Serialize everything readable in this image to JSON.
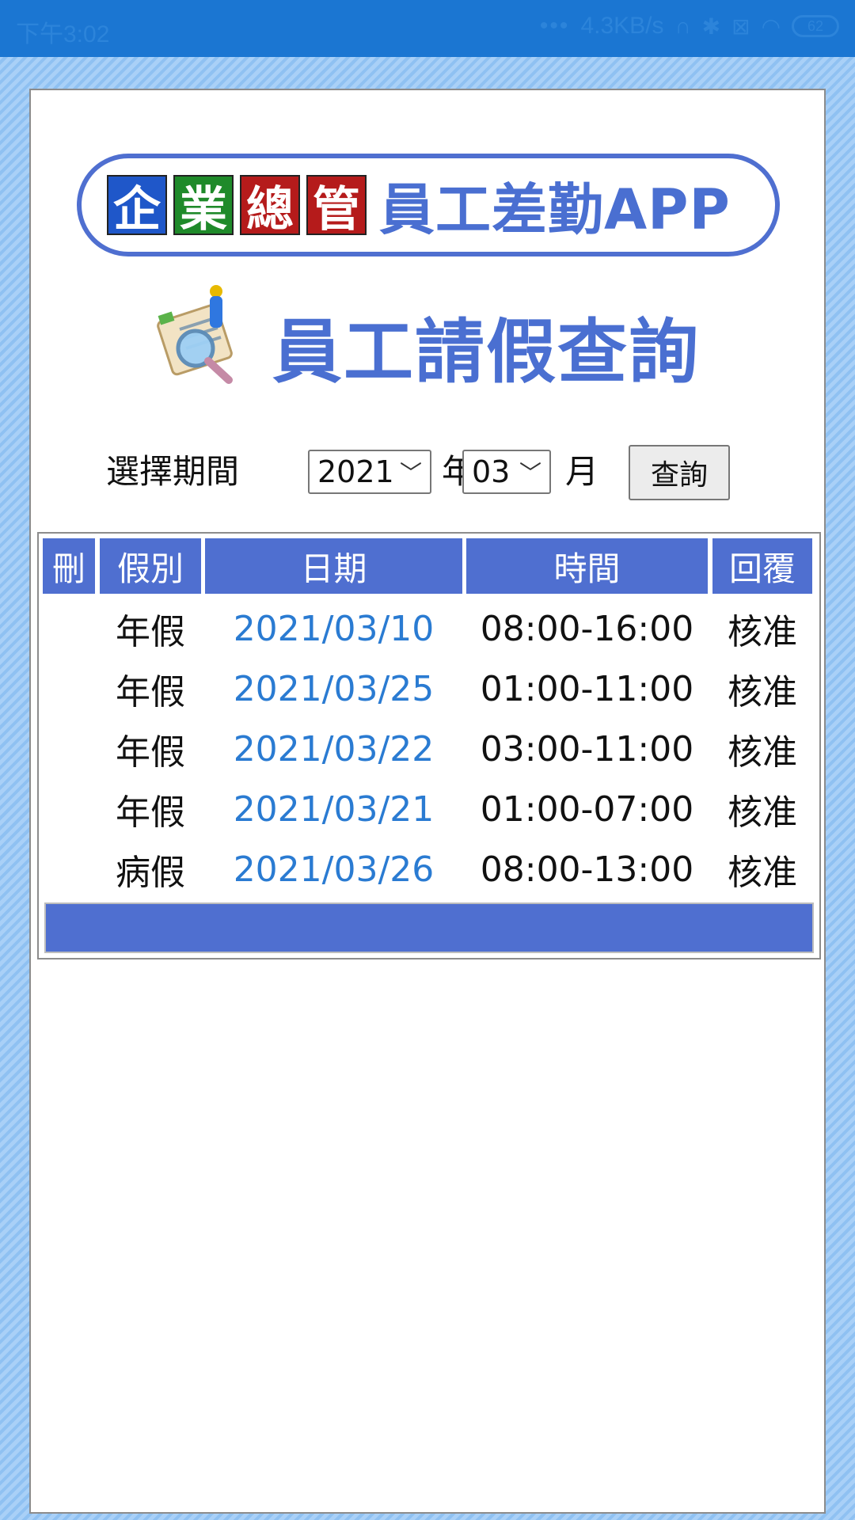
{
  "status_bar": {
    "time": "下午3:02",
    "network_speed": "4.3KB/s",
    "battery": "62"
  },
  "logo": {
    "chars": [
      "企",
      "業",
      "總",
      "管"
    ],
    "char_colors": [
      "#1f57c9",
      "#1f8a2a",
      "#b51b1b",
      "#b51b1b"
    ],
    "text": "員工差勤APP"
  },
  "title": "員工請假查詢",
  "filter": {
    "label": "選擇期間",
    "year_value": "2021",
    "year_unit": "年",
    "month_value": "03",
    "month_unit": "月",
    "query_label": "查詢"
  },
  "table": {
    "headers": {
      "delete": "刪",
      "type": "假別",
      "date": "日期",
      "time": "時間",
      "reply": "回覆"
    },
    "rows": [
      {
        "delete": "",
        "type": "年假",
        "date": "2021/03/10",
        "time": "08:00-16:00",
        "reply": "核准"
      },
      {
        "delete": "",
        "type": "年假",
        "date": "2021/03/25",
        "time": "01:00-11:00",
        "reply": "核准"
      },
      {
        "delete": "",
        "type": "年假",
        "date": "2021/03/22",
        "time": "03:00-11:00",
        "reply": "核准"
      },
      {
        "delete": "",
        "type": "年假",
        "date": "2021/03/21",
        "time": "01:00-07:00",
        "reply": "核准"
      },
      {
        "delete": "",
        "type": "病假",
        "date": "2021/03/26",
        "time": "08:00-13:00",
        "reply": "核准"
      }
    ]
  },
  "colors": {
    "accent": "#4f6fd0",
    "date_link": "#2a7bd2",
    "status_bar": "#1b76d2"
  }
}
